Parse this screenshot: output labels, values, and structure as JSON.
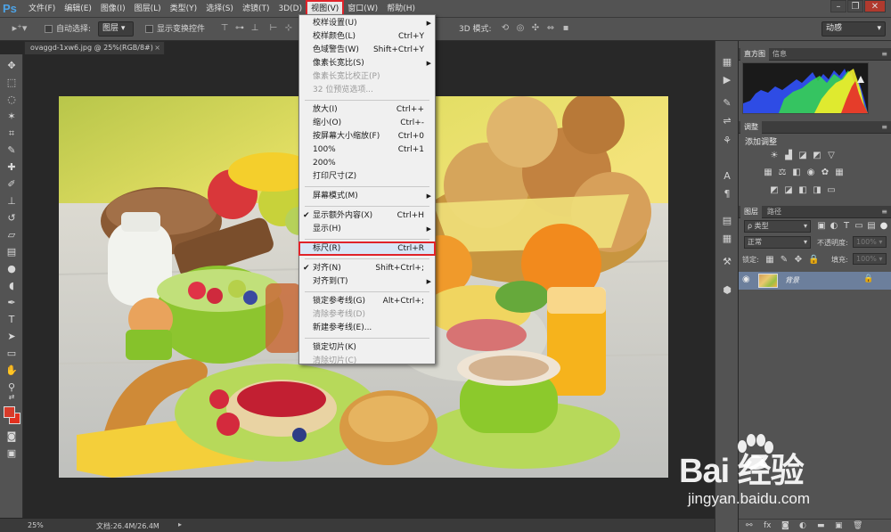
{
  "app": {
    "logo": "Ps",
    "menu": [
      "文件(F)",
      "编辑(E)",
      "图像(I)",
      "图层(L)",
      "类型(Y)",
      "选择(S)",
      "滤镜(T)",
      "3D(D)",
      "视图(V)",
      "窗口(W)",
      "帮助(H)"
    ],
    "active_menu": "视图(V)",
    "window_controls": [
      "–",
      "❐",
      "✕"
    ]
  },
  "options_bar": {
    "auto_select_label": "自动选择:",
    "auto_select_value": "图层",
    "show_transform_label": "显示变换控件",
    "mode_3d_label": "3D 模式:",
    "workspace_value": "动感"
  },
  "document": {
    "tab_title": "ovaggd-1xw6.jpg @ 25%(RGB/8#)",
    "tab_close": "×"
  },
  "status": {
    "zoom": "25%",
    "doc_size": "文档:26.4M/26.4M",
    "arrow": "▸"
  },
  "view_menu": {
    "items": [
      {
        "label": "校样设置(U)",
        "shortcut": "",
        "submenu": true,
        "disabled": false,
        "check": false
      },
      {
        "label": "校样颜色(L)",
        "shortcut": "Ctrl+Y",
        "submenu": false,
        "disabled": false,
        "check": false
      },
      {
        "label": "色域警告(W)",
        "shortcut": "Shift+Ctrl+Y",
        "submenu": false,
        "disabled": false,
        "check": false
      },
      {
        "label": "像素长宽比(S)",
        "shortcut": "",
        "submenu": true,
        "disabled": false,
        "check": false
      },
      {
        "label": "像素长宽比校正(P)",
        "shortcut": "",
        "submenu": false,
        "disabled": true,
        "check": false
      },
      {
        "label": "32 位预览选项...",
        "shortcut": "",
        "submenu": false,
        "disabled": true,
        "check": false
      },
      {
        "separator": true
      },
      {
        "label": "放大(I)",
        "shortcut": "Ctrl++",
        "submenu": false,
        "disabled": false,
        "check": false
      },
      {
        "label": "缩小(O)",
        "shortcut": "Ctrl+-",
        "submenu": false,
        "disabled": false,
        "check": false
      },
      {
        "label": "按屏幕大小缩放(F)",
        "shortcut": "Ctrl+0",
        "submenu": false,
        "disabled": false,
        "check": false
      },
      {
        "label": "100%",
        "shortcut": "Ctrl+1",
        "submenu": false,
        "disabled": false,
        "check": false
      },
      {
        "label": "200%",
        "shortcut": "",
        "submenu": false,
        "disabled": false,
        "check": false
      },
      {
        "label": "打印尺寸(Z)",
        "shortcut": "",
        "submenu": false,
        "disabled": false,
        "check": false
      },
      {
        "separator": true
      },
      {
        "label": "屏幕模式(M)",
        "shortcut": "",
        "submenu": true,
        "disabled": false,
        "check": false
      },
      {
        "separator": true
      },
      {
        "label": "显示额外内容(X)",
        "shortcut": "Ctrl+H",
        "submenu": false,
        "disabled": false,
        "check": true
      },
      {
        "label": "显示(H)",
        "shortcut": "",
        "submenu": true,
        "disabled": false,
        "check": false
      },
      {
        "separator": true
      },
      {
        "label": "标尺(R)",
        "shortcut": "Ctrl+R",
        "submenu": false,
        "disabled": false,
        "check": false,
        "highlight": true
      },
      {
        "separator": true
      },
      {
        "label": "对齐(N)",
        "shortcut": "Shift+Ctrl+;",
        "submenu": false,
        "disabled": false,
        "check": true
      },
      {
        "label": "对齐到(T)",
        "shortcut": "",
        "submenu": true,
        "disabled": false,
        "check": false
      },
      {
        "separator": true
      },
      {
        "label": "锁定参考线(G)",
        "shortcut": "Alt+Ctrl+;",
        "submenu": false,
        "disabled": false,
        "check": false
      },
      {
        "label": "清除参考线(D)",
        "shortcut": "",
        "submenu": false,
        "disabled": true,
        "check": false
      },
      {
        "label": "新建参考线(E)...",
        "shortcut": "",
        "submenu": false,
        "disabled": false,
        "check": false
      },
      {
        "separator": true
      },
      {
        "label": "锁定切片(K)",
        "shortcut": "",
        "submenu": false,
        "disabled": false,
        "check": false
      },
      {
        "label": "清除切片(C)",
        "shortcut": "",
        "submenu": false,
        "disabled": true,
        "check": false
      }
    ]
  },
  "panels": {
    "histogram_tabs": [
      "直方图",
      "信息"
    ],
    "adjust_tab": "调整",
    "adjust_title": "添加调整",
    "layers_tabs": [
      "图层",
      "路径"
    ],
    "kind_label": "ρ 类型",
    "blend_mode": "正常",
    "opacity_label": "不透明度:",
    "opacity_value": "100%",
    "lock_label": "锁定:",
    "fill_label": "填充:",
    "fill_value": "100%",
    "layer_name": "背景",
    "panel_menu": "≡"
  },
  "watermark": {
    "brand": "Bai 经验",
    "url": "jingyan.baidu.com"
  }
}
